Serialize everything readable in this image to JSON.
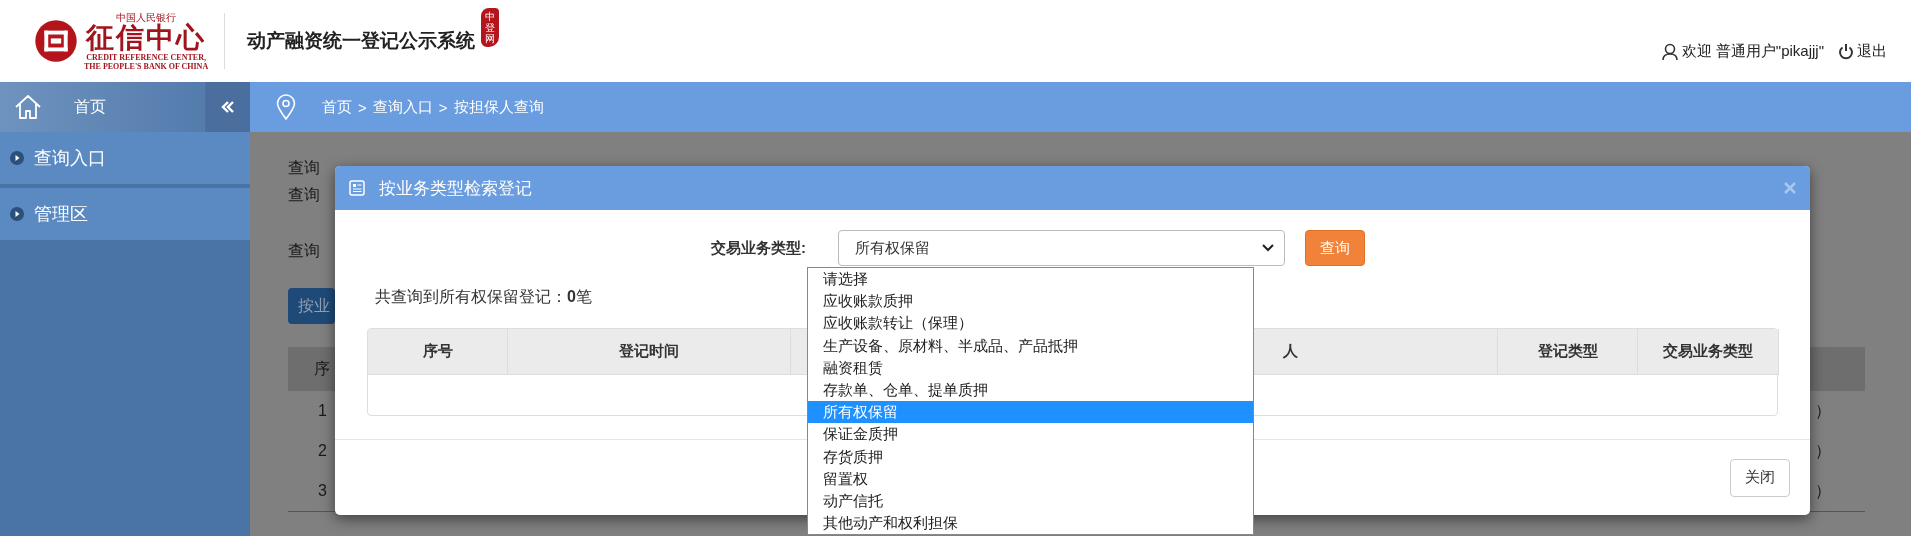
{
  "header": {
    "org_tagline": "中国人民银行",
    "org_name": "征信中心",
    "org_english": [
      "CREDIT REFERENCE CENTER,",
      "THE PEOPLE'S BANK OF CHINA"
    ],
    "system_title": "动产融资统一登记公示系统",
    "seal": "中登网",
    "welcome": "欢迎 普通用户\"pikajjj\"",
    "logout": "退出"
  },
  "sidebar": {
    "home": "首页",
    "items": [
      {
        "label": "查询入口"
      },
      {
        "label": "管理区"
      }
    ]
  },
  "breadcrumb": {
    "items": [
      "首页",
      "查询入口",
      "按担保人查询"
    ],
    "separator": ">"
  },
  "page": {
    "lines": [
      "查询",
      "查询",
      "查询"
    ],
    "button": "按业",
    "table_header": "序",
    "rows": [
      {
        "index": "1",
        "tail": "）"
      },
      {
        "index": "2",
        "tail": "）"
      },
      {
        "index": "3",
        "tail": "）"
      }
    ]
  },
  "modal": {
    "title": "按业务类型检索登记",
    "filter_label": "交易业务类型:",
    "select_value": "所有权保留",
    "search_button": "查询",
    "summary": "共查询到所有权保留登记：**0**笔",
    "columns": [
      {
        "label": "序号"
      },
      {
        "label": "登记时间"
      },
      {
        "label": "人"
      },
      {
        "label": "登记类型"
      },
      {
        "label": "交易业务类型"
      }
    ],
    "options": [
      {
        "label": "请选择",
        "selected": false
      },
      {
        "label": "应收账款质押",
        "selected": false
      },
      {
        "label": "应收账款转让（保理）",
        "selected": false
      },
      {
        "label": "生产设备、原材料、半成品、产品抵押",
        "selected": false
      },
      {
        "label": "融资租赁",
        "selected": false
      },
      {
        "label": "存款单、仓单、提单质押",
        "selected": false
      },
      {
        "label": "所有权保留",
        "selected": true
      },
      {
        "label": "保证金质押",
        "selected": false
      },
      {
        "label": "存货质押",
        "selected": false
      },
      {
        "label": "留置权",
        "selected": false
      },
      {
        "label": "动产信托",
        "selected": false
      },
      {
        "label": "其他动产和权利担保",
        "selected": false
      }
    ],
    "close_button": "关闭"
  }
}
